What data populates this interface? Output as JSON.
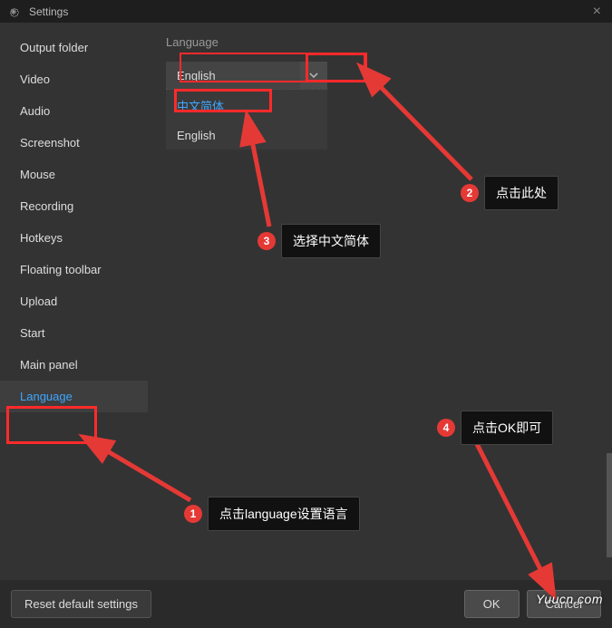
{
  "titlebar": {
    "title": "Settings"
  },
  "sidebar": {
    "items": [
      {
        "label": "Output folder"
      },
      {
        "label": "Video"
      },
      {
        "label": "Audio"
      },
      {
        "label": "Screenshot"
      },
      {
        "label": "Mouse"
      },
      {
        "label": "Recording"
      },
      {
        "label": "Hotkeys"
      },
      {
        "label": "Floating toolbar"
      },
      {
        "label": "Upload"
      },
      {
        "label": "Start"
      },
      {
        "label": "Main panel"
      },
      {
        "label": "Language"
      }
    ],
    "active_index": 11
  },
  "content": {
    "section_label": "Language",
    "dropdown_value": "English",
    "options": [
      {
        "label": "中文简体",
        "highlighted": true
      },
      {
        "label": "English",
        "highlighted": false
      }
    ]
  },
  "footer": {
    "reset_label": "Reset default settings",
    "ok_label": "OK",
    "cancel_label": "Cancel"
  },
  "annotations": {
    "step1": "点击language设置语言",
    "step2": "点击此处",
    "step3": "选择中文简体",
    "step4": "点击OK即可"
  },
  "watermark": "Yuucn.com"
}
